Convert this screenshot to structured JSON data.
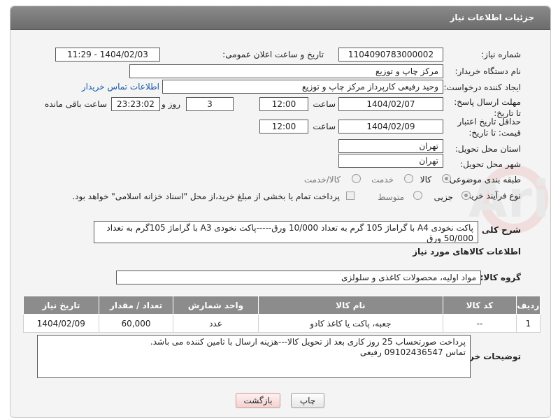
{
  "header": {
    "title": "جزئیات اطلاعات نیاز"
  },
  "form": {
    "need_number": {
      "label": "شماره نیاز:",
      "value": "1104090783000002"
    },
    "announce_datetime": {
      "label": "تاریخ و ساعت اعلان عمومی:",
      "value": "1404/02/03 - 11:29"
    },
    "buyer_org": {
      "label": "نام دستگاه خریدار:",
      "value": "مرکز چاپ و توزیع"
    },
    "requester": {
      "label": "ایجاد کننده درخواست:",
      "value": "وحید رفیعی  کارپرداز مرکز چاپ و توزیع",
      "contact_link": "اطلاعات تماس خریدار"
    },
    "reply_deadline": {
      "label": "مهلت ارسال پاسخ: تا تاریخ:",
      "date": "1404/02/07",
      "time_label": "ساعت",
      "time": "12:00",
      "days": "3",
      "days_label": "روز و",
      "remaining": "23:23:02",
      "remaining_label": "ساعت باقی مانده"
    },
    "price_validity": {
      "label": "حداقل تاریخ اعتبار قیمت: تا تاریخ:",
      "date": "1404/02/09",
      "time_label": "ساعت",
      "time": "12:00"
    },
    "delivery_province": {
      "label": "استان محل تحویل:",
      "value": "تهران"
    },
    "delivery_city": {
      "label": "شهر محل تحویل:",
      "value": "تهران"
    },
    "category": {
      "label": "طبقه بندی موضوعی:",
      "options": [
        "کالا",
        "خدمت",
        "کالا/خدمت"
      ],
      "selected": "کالا"
    },
    "purchase_type": {
      "label": "نوع فرآیند خرید :",
      "options": [
        "جزیی",
        "متوسط"
      ],
      "selected": "جزیی",
      "note": "پرداخت تمام یا بخشی از مبلغ خرید،از محل \"اسناد خزانه اسلامی\" خواهد بود."
    },
    "general_desc": {
      "label": "شرح کلی نیاز:",
      "value": "پاکت نخودی A4 با گراماژ 105 گرم به تعداد 10/000 ورق-----پاکت نخودی A3 با گراماژ 105گرم به تعداد 50/000 ورق"
    }
  },
  "goods": {
    "section_title": "اطلاعات کالاهای مورد نیاز",
    "group_label": "گروه کالا:",
    "group_value": "مواد اولیه، محصولات کاغذی و سلولزی",
    "columns": [
      "ردیف",
      "کد کالا",
      "نام کالا",
      "واحد شمارش",
      "تعداد / مقدار",
      "تاریخ نیاز"
    ],
    "rows": [
      {
        "row": "1",
        "code": "--",
        "name": "جعبه، پاکت یا کاغذ کادو",
        "unit": "عدد",
        "qty": "60,000",
        "date": "1404/02/09"
      }
    ]
  },
  "buyer_notes": {
    "label": "توضیحات خریدار:",
    "line1": "پرداخت صورتحساب 25 روز کاری بعد از تحویل کالا---هزینه ارسال با تامین کننده می باشد.",
    "line2": "تماس 09102436547 رفیعی"
  },
  "buttons": {
    "print": "چاپ",
    "back": "بازگشت"
  },
  "watermark": {
    "text": "AriaTender.neT"
  },
  "colors": {
    "header": "#7a7a7a",
    "link": "#1a5aa8",
    "back_button": "#f3d1d1",
    "watermark": "#d9534f"
  }
}
